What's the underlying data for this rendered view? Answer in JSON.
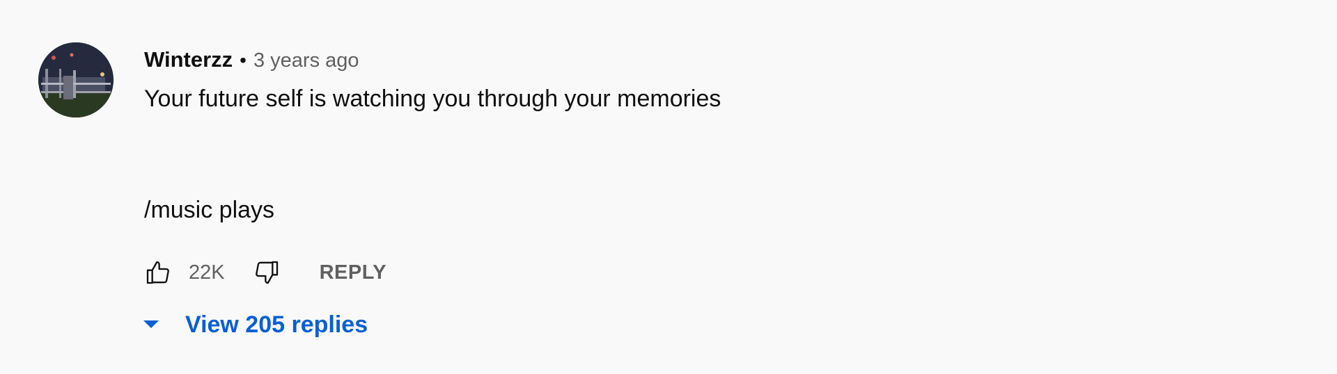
{
  "comment": {
    "author": "Winterzz",
    "separator": "•",
    "timestamp": "3 years ago",
    "text_lines": [
      "Your future self is watching you through your memories",
      "/music plays"
    ],
    "like_count": "22K",
    "reply_label": "REPLY",
    "view_replies_label": "View 205 replies"
  },
  "icons": {
    "like": "thumbs-up-icon",
    "dislike": "thumbs-down-icon",
    "expand": "caret-down-icon"
  },
  "colors": {
    "background": "#f9f9f9",
    "text_primary": "#0f0f0f",
    "text_secondary": "#606060",
    "link_blue": "#065fd4"
  }
}
